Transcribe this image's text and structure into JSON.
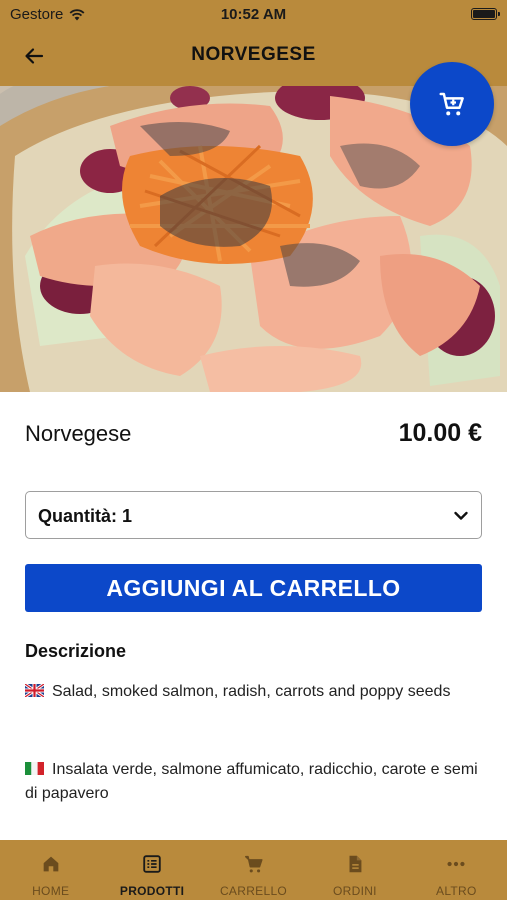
{
  "status_bar": {
    "carrier": "Gestore",
    "time": "10:52 AM"
  },
  "nav": {
    "title": "NORVEGESE"
  },
  "product": {
    "name": "Norvegese",
    "price": "10.00 €",
    "image_count": 1,
    "active_image": 1
  },
  "quantity": {
    "label": "Quantità: 1"
  },
  "add_to_cart_label": "AGGIUNGI AL CARRELLO",
  "description": {
    "title": "Descrizione",
    "english": "Salad, smoked salmon, radish, carrots and poppy seeds",
    "italian": "Insalata verde, salmone affumicato, radicchio, carote e semi di papavero"
  },
  "tabs": [
    {
      "label": "HOME",
      "icon": "home-icon"
    },
    {
      "label": "PRODOTTI",
      "icon": "list-icon",
      "active": true
    },
    {
      "label": "CARRELLO",
      "icon": "cart-icon"
    },
    {
      "label": "ORDINI",
      "icon": "document-icon"
    },
    {
      "label": "ALTRO",
      "icon": "more-icon"
    }
  ],
  "colors": {
    "brand": "#b98a3c",
    "accent": "#0c48c9"
  }
}
